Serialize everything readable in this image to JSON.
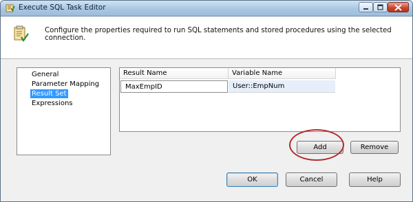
{
  "window": {
    "title": "Execute SQL Task Editor"
  },
  "header": {
    "description": "Configure the properties required to run SQL statements and stored procedures using the selected connection."
  },
  "nav": {
    "items": [
      "General",
      "Parameter Mapping",
      "Result Set",
      "Expressions"
    ],
    "selected": "Result Set"
  },
  "grid": {
    "columns": [
      "Result Name",
      "Variable Name"
    ],
    "rows": [
      {
        "result_name": "MaxEmpID",
        "variable_name": "User::EmpNum"
      }
    ]
  },
  "buttons": {
    "add": "Add",
    "remove": "Remove",
    "ok": "OK",
    "cancel": "Cancel",
    "help": "Help"
  },
  "colors": {
    "selection": "#3399ff",
    "annotation_ring": "#b22a2a",
    "titlebar": "#a9c7e2"
  }
}
